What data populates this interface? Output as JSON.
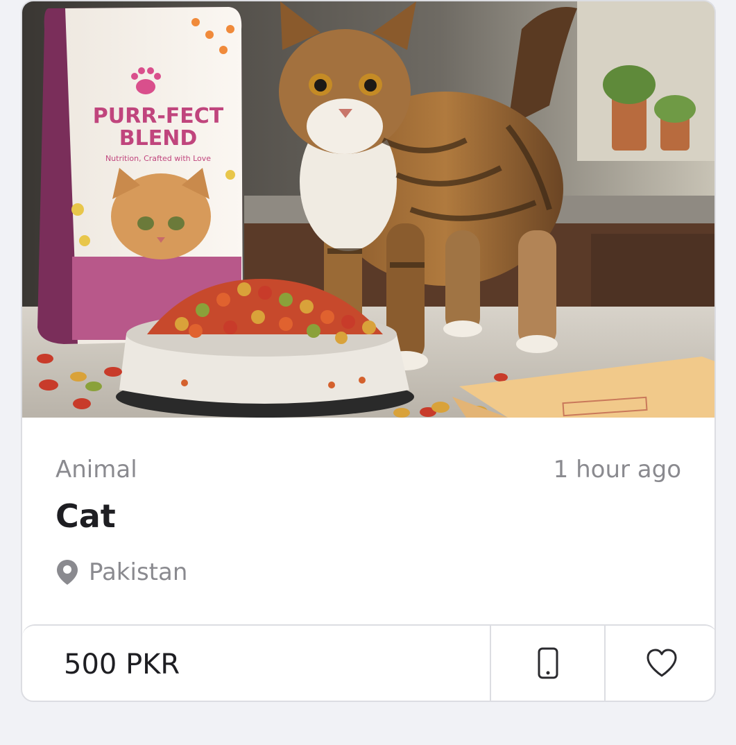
{
  "listing": {
    "image_icon": "cat-with-food-bowl-photo",
    "category": "Animal",
    "posted_time": "1 hour ago",
    "title": "Cat",
    "location": "Pakistan",
    "location_icon": "map-pin-icon",
    "price": "500 PKR",
    "phone_icon": "mobile-phone-icon",
    "favorite_icon": "heart-icon",
    "package_text_line1": "PURR-FECT",
    "package_text_line2": "BLEND",
    "package_tagline": "Nutrition, Crafted with Love"
  },
  "colors": {
    "background": "#f1f2f6",
    "card": "#ffffff",
    "border": "#dcdde2",
    "muted_text": "#8a8a8f",
    "primary_text": "#1e1e22",
    "package_accent": "#c0457d"
  }
}
